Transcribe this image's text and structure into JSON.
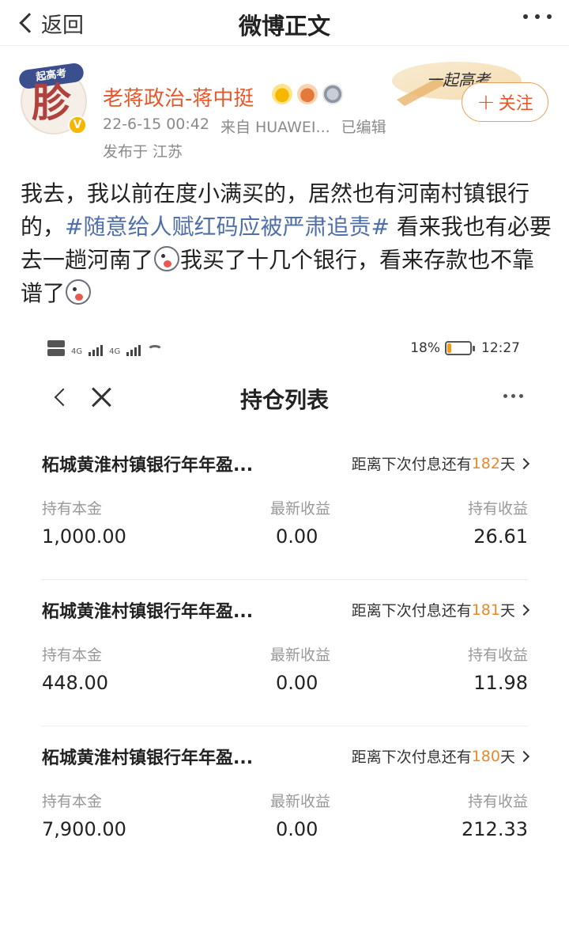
{
  "nav": {
    "back_label": "返回",
    "title": "微博正文"
  },
  "post": {
    "avatar": {
      "ribbon_text": "起高考",
      "glyph": "胗"
    },
    "author": "老蒋政治-蒋中挺",
    "badges": [
      "crown-icon",
      "hand-icon",
      "medal-icon"
    ],
    "timestamp": "22-6-15 00:42",
    "source": "来自 HUAWEI...",
    "edited": "已编辑",
    "location": "发布于 江苏",
    "decoration_text": "一起高考",
    "follow_label": "关注",
    "text": {
      "part1": "我去，我以前在度小满买的，居然也有河南村镇银行的，",
      "hashtag": "#随意给人赋红码应被严肃追责#",
      "part2": "  看来我也有必要去一趟河南了",
      "part3": "我买了十几个银行，看来存款也不靠谱了"
    }
  },
  "screenshot": {
    "status": {
      "network_labels": [
        "4G",
        "4G"
      ],
      "battery_percent": "18%",
      "battery_level": 0.18,
      "time": "12:27"
    },
    "title": "持仓列表",
    "holdings": [
      {
        "name": "柘城黄淮村镇银行年年盈...",
        "next_prefix": "距离下次付息还有",
        "next_days": "182",
        "next_suffix": "天",
        "principal_label": "持有本金",
        "latest_label": "最新收益",
        "holding_label": "持有收益",
        "principal": "1,000.00",
        "latest": "0.00",
        "holding": "26.61"
      },
      {
        "name": "柘城黄淮村镇银行年年盈...",
        "next_prefix": "距离下次付息还有",
        "next_days": "181",
        "next_suffix": "天",
        "principal_label": "持有本金",
        "latest_label": "最新收益",
        "holding_label": "持有收益",
        "principal": "448.00",
        "latest": "0.00",
        "holding": "11.98"
      },
      {
        "name": "柘城黄淮村镇银行年年盈...",
        "next_prefix": "距离下次付息还有",
        "next_days": "180",
        "next_suffix": "天",
        "principal_label": "持有本金",
        "latest_label": "最新收益",
        "holding_label": "持有收益",
        "principal": "7,900.00",
        "latest": "0.00",
        "holding": "212.33"
      }
    ]
  },
  "colors": {
    "username": "#e4582b",
    "hashtag": "#4f6fa8",
    "days_accent": "#e58a2c",
    "meta_gray": "#8a8a8a"
  }
}
